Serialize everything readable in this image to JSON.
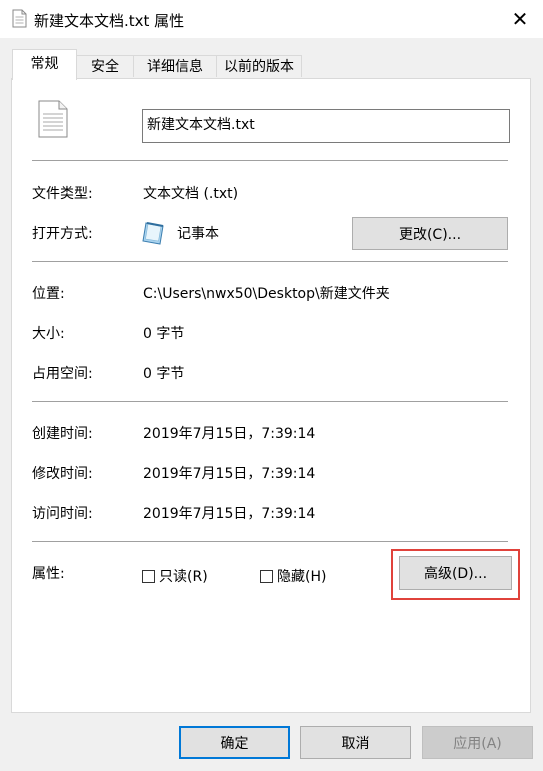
{
  "window": {
    "title": "新建文本文档.txt 属性"
  },
  "tabs": [
    {
      "label": "常规"
    },
    {
      "label": "安全"
    },
    {
      "label": "详细信息"
    },
    {
      "label": "以前的版本"
    }
  ],
  "file": {
    "name": "新建文本文档.txt"
  },
  "fields": {
    "type_label": "文件类型:",
    "type_value": "文本文档 (.txt)",
    "open_label": "打开方式:",
    "open_value": "记事本",
    "change_button": "更改(C)...",
    "location_label": "位置:",
    "location_value": "C:\\Users\\nwx50\\Desktop\\新建文件夹",
    "size_label": "大小:",
    "size_value": "0 字节",
    "disk_label": "占用空间:",
    "disk_value": "0 字节",
    "created_label": "创建时间:",
    "created_value": "2019年7月15日，7:39:14",
    "modified_label": "修改时间:",
    "modified_value": "2019年7月15日，7:39:14",
    "accessed_label": "访问时间:",
    "accessed_value": "2019年7月15日，7:39:14",
    "attributes_label": "属性:",
    "readonly_label": "只读(R)",
    "hidden_label": "隐藏(H)",
    "advanced_button": "高级(D)..."
  },
  "footer": {
    "ok": "确定",
    "cancel": "取消",
    "apply": "应用(A)"
  },
  "colors": {
    "accent": "#0078d7",
    "highlight": "#e0423b"
  }
}
